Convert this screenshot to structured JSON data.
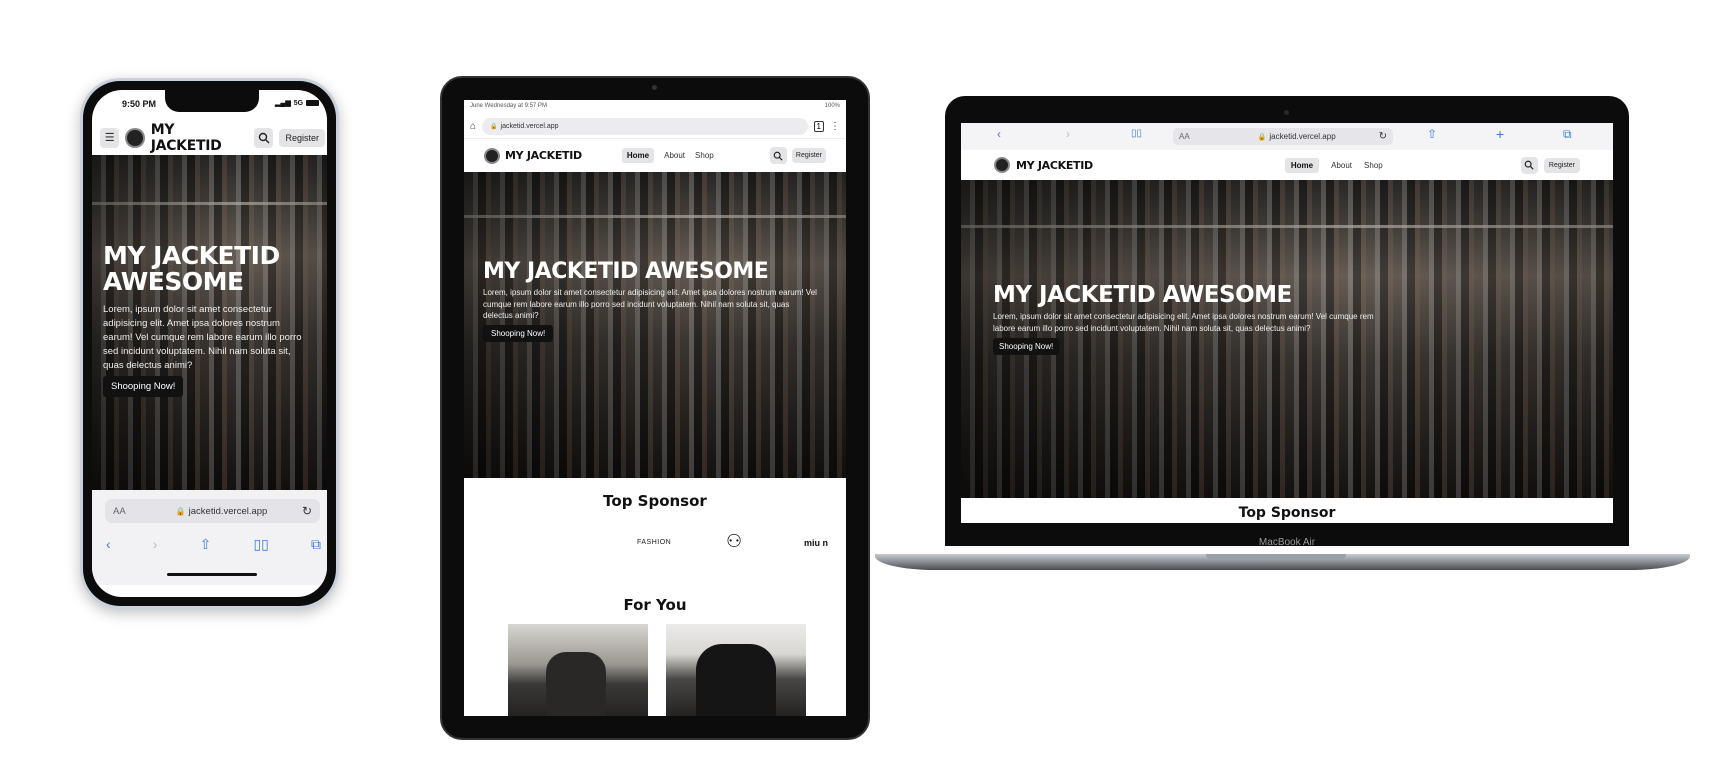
{
  "site": {
    "brand": "MY JACKETID",
    "nav": [
      "Home",
      "About",
      "Shop"
    ],
    "register_label": "Register",
    "hero_title": "MY JACKETID AWESOME",
    "hero_text": "Lorem, ipsum dolor sit amet consectetur adipisicing elit. Amet ipsa dolores nostrum earum! Vel cumque rem labore earum illo porro sed incidunt voluptatem. Nihil nam soluta sit, quas delectus animi?",
    "hero_button": "Shooping Now!",
    "sponsor_title": "Top Sponsor",
    "sponsor_title_laptop": "Top Sponsor",
    "sponsors": [
      "FASHION",
      "miu n"
    ],
    "foryou_title": "For You"
  },
  "phone": {
    "time": "9:50 PM",
    "signal": "5G",
    "title_line1": "MY JACKETID",
    "title_line2": "AWESOME",
    "url_prefix": "AA",
    "url": "jacketid.vercel.app"
  },
  "tablet": {
    "status_left": "June Wednesday at 9:57 PM",
    "status_right": "100%",
    "url": "jacketid.vercel.app"
  },
  "laptop": {
    "url_prefix": "AA",
    "url": "jacketid.vercel.app",
    "model": "MacBook Air"
  }
}
